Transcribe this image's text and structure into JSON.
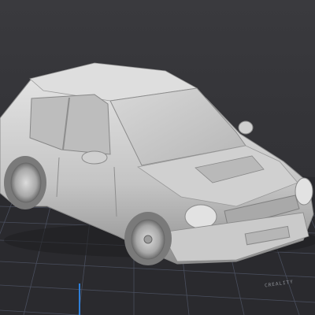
{
  "viewport": {
    "background_color": "#38383c",
    "grid_color": "#5a6070",
    "model_color": "#c9c9c9",
    "axis_color": "#2f7fd8"
  },
  "model": {
    "name_icon": "car-model-icon"
  },
  "bed": {
    "label": "CREALITY"
  }
}
